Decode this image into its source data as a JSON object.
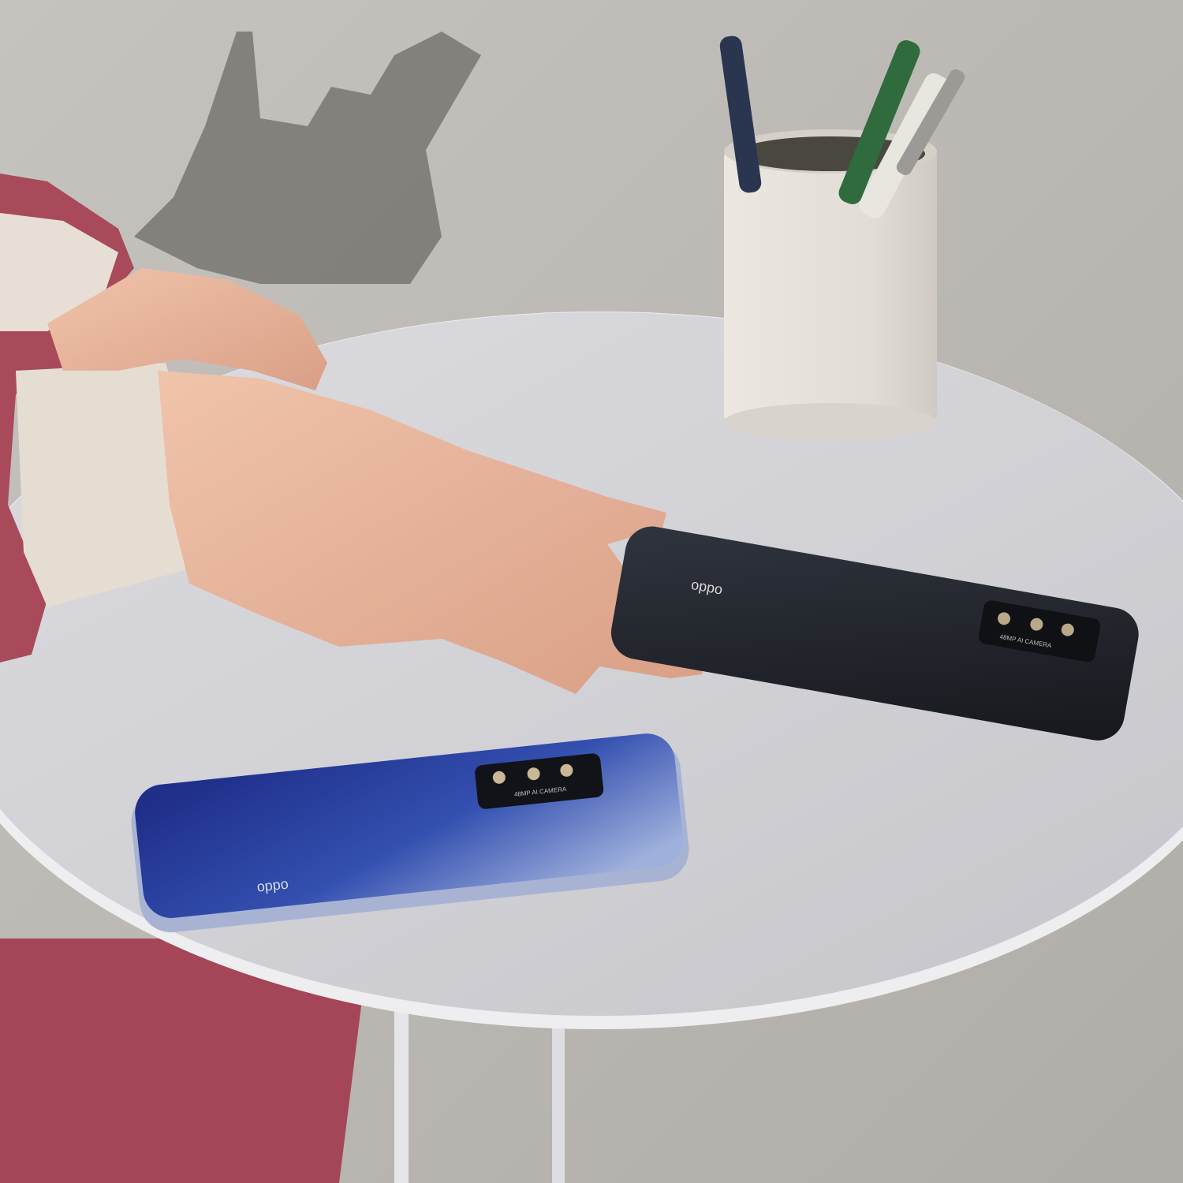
{
  "scene": {
    "colors": {
      "wall": "#bdbbb7",
      "wall_shadow": "#6e6b66",
      "table_top": "#d4d4d8",
      "table_edge": "#f2f2f4",
      "skin": "#e8b49a",
      "sleeve_knit": "#e6ddd2",
      "jacket": "#a84a5a",
      "blue_phone": "#2a3f9c",
      "black_phone": "#22252c",
      "cup": "#e5e1da"
    }
  },
  "phone_black": {
    "brand_label": "oppo",
    "camera_label": "48MP AI CAMERA"
  },
  "phone_blue": {
    "brand_label": "oppo",
    "camera_label": "48MP AI CAMERA"
  }
}
